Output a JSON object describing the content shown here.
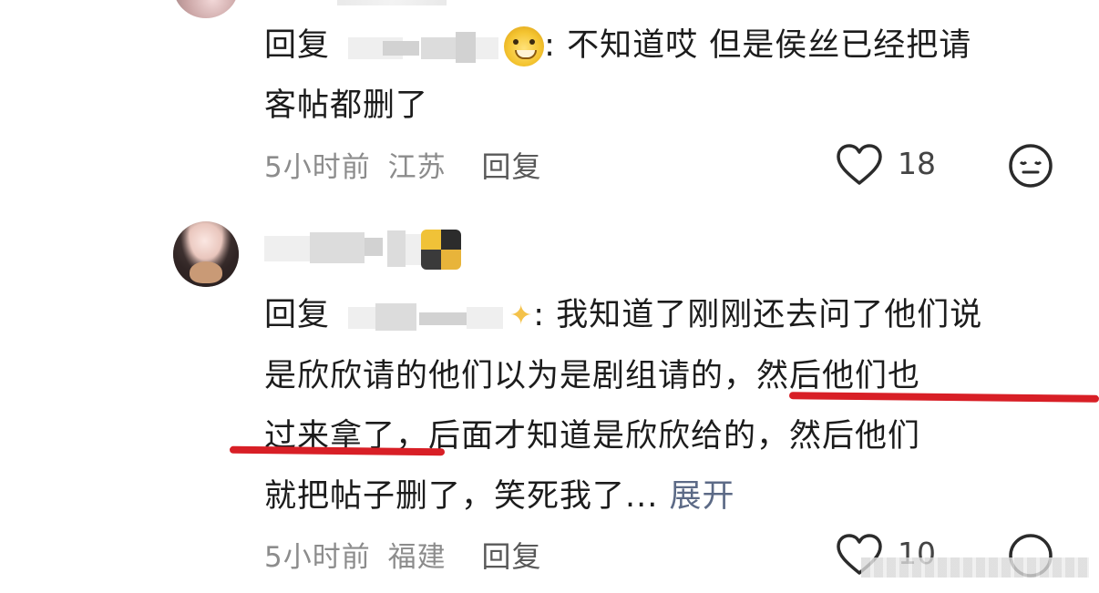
{
  "comment1": {
    "reply_prefix": "回复",
    "reply_to_masked": "",
    "body_line1": ": 不知道哎  但是侯丝已经把请",
    "body_line2": "客帖都删了",
    "time": "5小时前",
    "location": "江苏",
    "reply_button": "回复",
    "like_count": "18"
  },
  "comment2": {
    "username_masked": "",
    "reply_prefix": "回复",
    "body_line1": ": 我知道了刚刚还去问了他们说",
    "body_line2": "是欣欣请的他们以为是剧组请的，然后他们也",
    "body_line3": "过来拿了，后面才知道是欣欣给的，然后他们",
    "body_line4_text": "就把帖子删了，笑死我了... ",
    "expand_label": "展开",
    "time": "5小时前",
    "location": "福建",
    "reply_button": "回复",
    "like_count": "10"
  },
  "colors": {
    "underline": "#d81f26",
    "meta_gray": "#8c8c8c",
    "expand_link": "#5c6a86"
  },
  "icons": {
    "like": "heart-outline-icon",
    "emoji_reaction": "neutral-face-icon",
    "emoji_more": "face-icon",
    "sparkle": "sparkle-icon",
    "tiger_emoji": "tiger-emoji-icon"
  }
}
